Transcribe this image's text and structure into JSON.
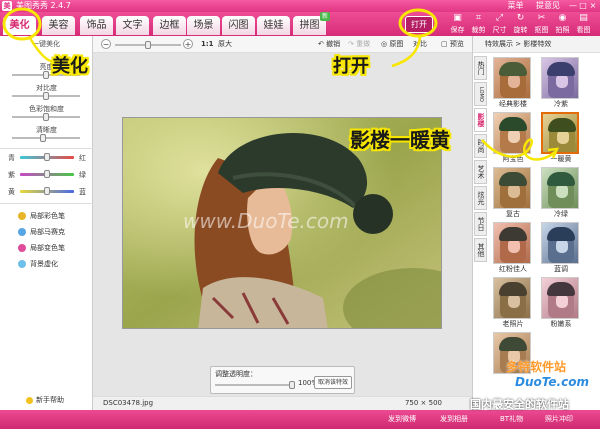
{
  "app": {
    "title": "美图秀秀 2.4.7",
    "icon_letter": "美"
  },
  "menu": [
    "菜单",
    "提意见"
  ],
  "window_buttons": [
    "—",
    "□",
    "×"
  ],
  "tabs": [
    {
      "label": "美化",
      "active": true
    },
    {
      "label": "美容"
    },
    {
      "label": "饰品"
    },
    {
      "label": "文字"
    },
    {
      "label": "边框"
    },
    {
      "label": "场景"
    },
    {
      "label": "闪图"
    },
    {
      "label": "娃娃"
    },
    {
      "label": "拼图",
      "badge": "新"
    }
  ],
  "open_button": "打开",
  "tools": [
    {
      "label": "保存",
      "icon": "save-icon"
    },
    {
      "label": "裁剪",
      "icon": "crop-icon"
    },
    {
      "label": "尺寸",
      "icon": "resize-icon"
    },
    {
      "label": "旋转",
      "icon": "rotate-icon"
    },
    {
      "label": "抠图",
      "icon": "cutout-icon"
    },
    {
      "label": "拍照",
      "icon": "camera-icon"
    },
    {
      "label": "看图",
      "icon": "view-icon"
    }
  ],
  "left_panel": {
    "header": "一键美化",
    "sliders": [
      {
        "label": "亮度",
        "value": 0.5
      },
      {
        "label": "对比度",
        "value": 0.5
      },
      {
        "label": "色彩饱和度",
        "value": 0.5
      },
      {
        "label": "清晰度",
        "value": 0.45
      }
    ],
    "color_sliders": [
      {
        "left": "青",
        "right": "红",
        "value": 0.5
      },
      {
        "left": "紫",
        "right": "绿",
        "value": 0.5
      },
      {
        "left": "黄",
        "right": "蓝",
        "value": 0.5
      }
    ],
    "effects": [
      {
        "label": "局部彩色笔",
        "color": "#e7b62a"
      },
      {
        "label": "局部马赛克",
        "color": "#56a6e4"
      },
      {
        "label": "局部变色笔",
        "color": "#e04c9a"
      },
      {
        "label": "背景虚化",
        "color": "#6cc0ea"
      }
    ],
    "help": "新手帮助"
  },
  "canvas_toolbar": {
    "zoom_text": "1:1",
    "original_size": "原大",
    "undo": "撤销",
    "redo": "重做",
    "compare_original": "原图",
    "compare_edited": "对比",
    "preview": "预览"
  },
  "opacity": {
    "label": "调整透明度：",
    "value": "100%",
    "cancel": "取消该特效"
  },
  "status": {
    "filename": "DSC03478.jpg",
    "dimensions": "750 × 500"
  },
  "right_panel": {
    "header": "特效展示 > 影楼特效",
    "tabs": [
      "热门",
      "LOMO",
      "影楼",
      "时尚",
      "艺术",
      "炫光",
      "节日",
      "其他"
    ],
    "active_tab": "影楼",
    "thumbs": [
      {
        "label": "经典影楼",
        "hat": "#4b5d38",
        "hair": "#a86b3a",
        "face": "#e4b498"
      },
      {
        "label": "冷紫",
        "hat": "#3a3f6e",
        "hair": "#7b6aa0",
        "face": "#d9c6e6"
      },
      {
        "label": "阿宝色",
        "hat": "#2b4a2c",
        "hair": "#b47a4a",
        "face": "#f0d0b4"
      },
      {
        "label": "一暖黄",
        "hat": "#3e4e1e",
        "hair": "#9b8a3a",
        "face": "#e6d296",
        "selected": true
      },
      {
        "label": "复古",
        "hat": "#3b4b35",
        "hair": "#a0703c",
        "face": "#dcbc94"
      },
      {
        "label": "冷绿",
        "hat": "#2f5a3e",
        "hair": "#6f8e5a",
        "face": "#cce0c0"
      },
      {
        "label": "红粉佳人",
        "hat": "#3c3a32",
        "hair": "#b06a4a",
        "face": "#f2c0b0"
      },
      {
        "label": "蓝调",
        "hat": "#2a3e5a",
        "hair": "#5a6f8e",
        "face": "#c8d6e8"
      },
      {
        "label": "老照片",
        "hat": "#4a4030",
        "hair": "#8a6e46",
        "face": "#d8c0a0"
      },
      {
        "label": "粉嫩系",
        "hat": "#44373e",
        "hair": "#b07a86",
        "face": "#f4d0d8"
      },
      {
        "label": "",
        "hat": "#3e4a36",
        "hair": "#a67c50",
        "face": "#e8c8a8"
      }
    ]
  },
  "bottom_bar": [
    "发到微博",
    "发到相册",
    "BT礼物",
    "照片冲印"
  ],
  "annotations": {
    "beautify": "美化",
    "open": "打开",
    "warm_yellow": "影楼一暖黄"
  },
  "watermarks": {
    "photo": "www.DuoTe.com",
    "brand": "多特软件站",
    "brand_url": "DuoTe.com",
    "slogan": "国内最安全的软件站"
  },
  "colors": {
    "brand_pink": "#e13583",
    "accent_yellow": "#f7e600"
  }
}
